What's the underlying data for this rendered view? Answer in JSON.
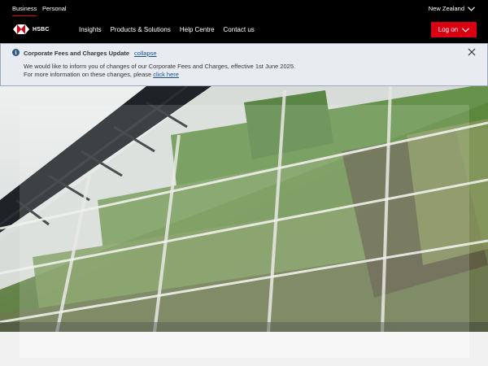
{
  "topbar": {
    "segments": [
      "Business",
      "Personal"
    ],
    "region": "New Zealand"
  },
  "nav": {
    "logo_text": "HSBC",
    "links": [
      "Insights",
      "Products & Solutions",
      "Help Centre",
      "Contact us"
    ],
    "logon_label": "Log on"
  },
  "notice": {
    "title": "Corporate Fees and Charges Update",
    "collapse_label": "collapse",
    "line1": "We would like to inform you of changes of our Corporate Fees and Charges, effective 1st June 2025.",
    "line2_prefix": "For more information on these changes, please",
    "link_label": "click here"
  },
  "colors": {
    "brand_red": "#db0011",
    "nav_bg": "#000000",
    "notice_bg": "#e8ecf0",
    "link": "#1a4f91"
  },
  "icons": {
    "region_chevron": "chevron-down-icon",
    "logon_chevron": "chevron-down-icon",
    "info": "info-icon",
    "close": "close-icon"
  }
}
